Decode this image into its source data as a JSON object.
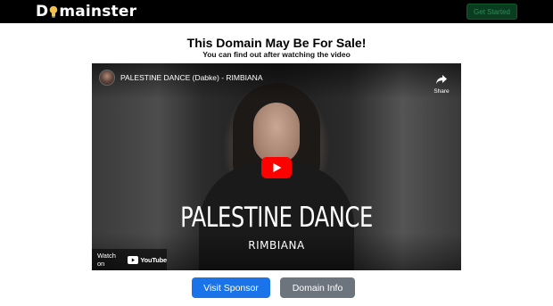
{
  "header": {
    "logo_prefix": "D",
    "logo_suffix": "mainster",
    "get_started_label": "Get Started",
    "accent_color": "#198754"
  },
  "main": {
    "headline": "This Domain May Be For Sale!",
    "subline": "You can find out after watching the video"
  },
  "video": {
    "title": "PALESTINE DANCE (Dabke) - RIMBIANA",
    "share_label": "Share",
    "overlay_title": "PALESTINE DANCE",
    "overlay_subtitle": "RIMBIANA",
    "watch_on_label": "Watch on",
    "youtube_label": "YouTube",
    "play_button_color": "#ff0000"
  },
  "actions": {
    "visit_sponsor_label": "Visit Sponsor",
    "domain_info_label": "Domain Info"
  }
}
